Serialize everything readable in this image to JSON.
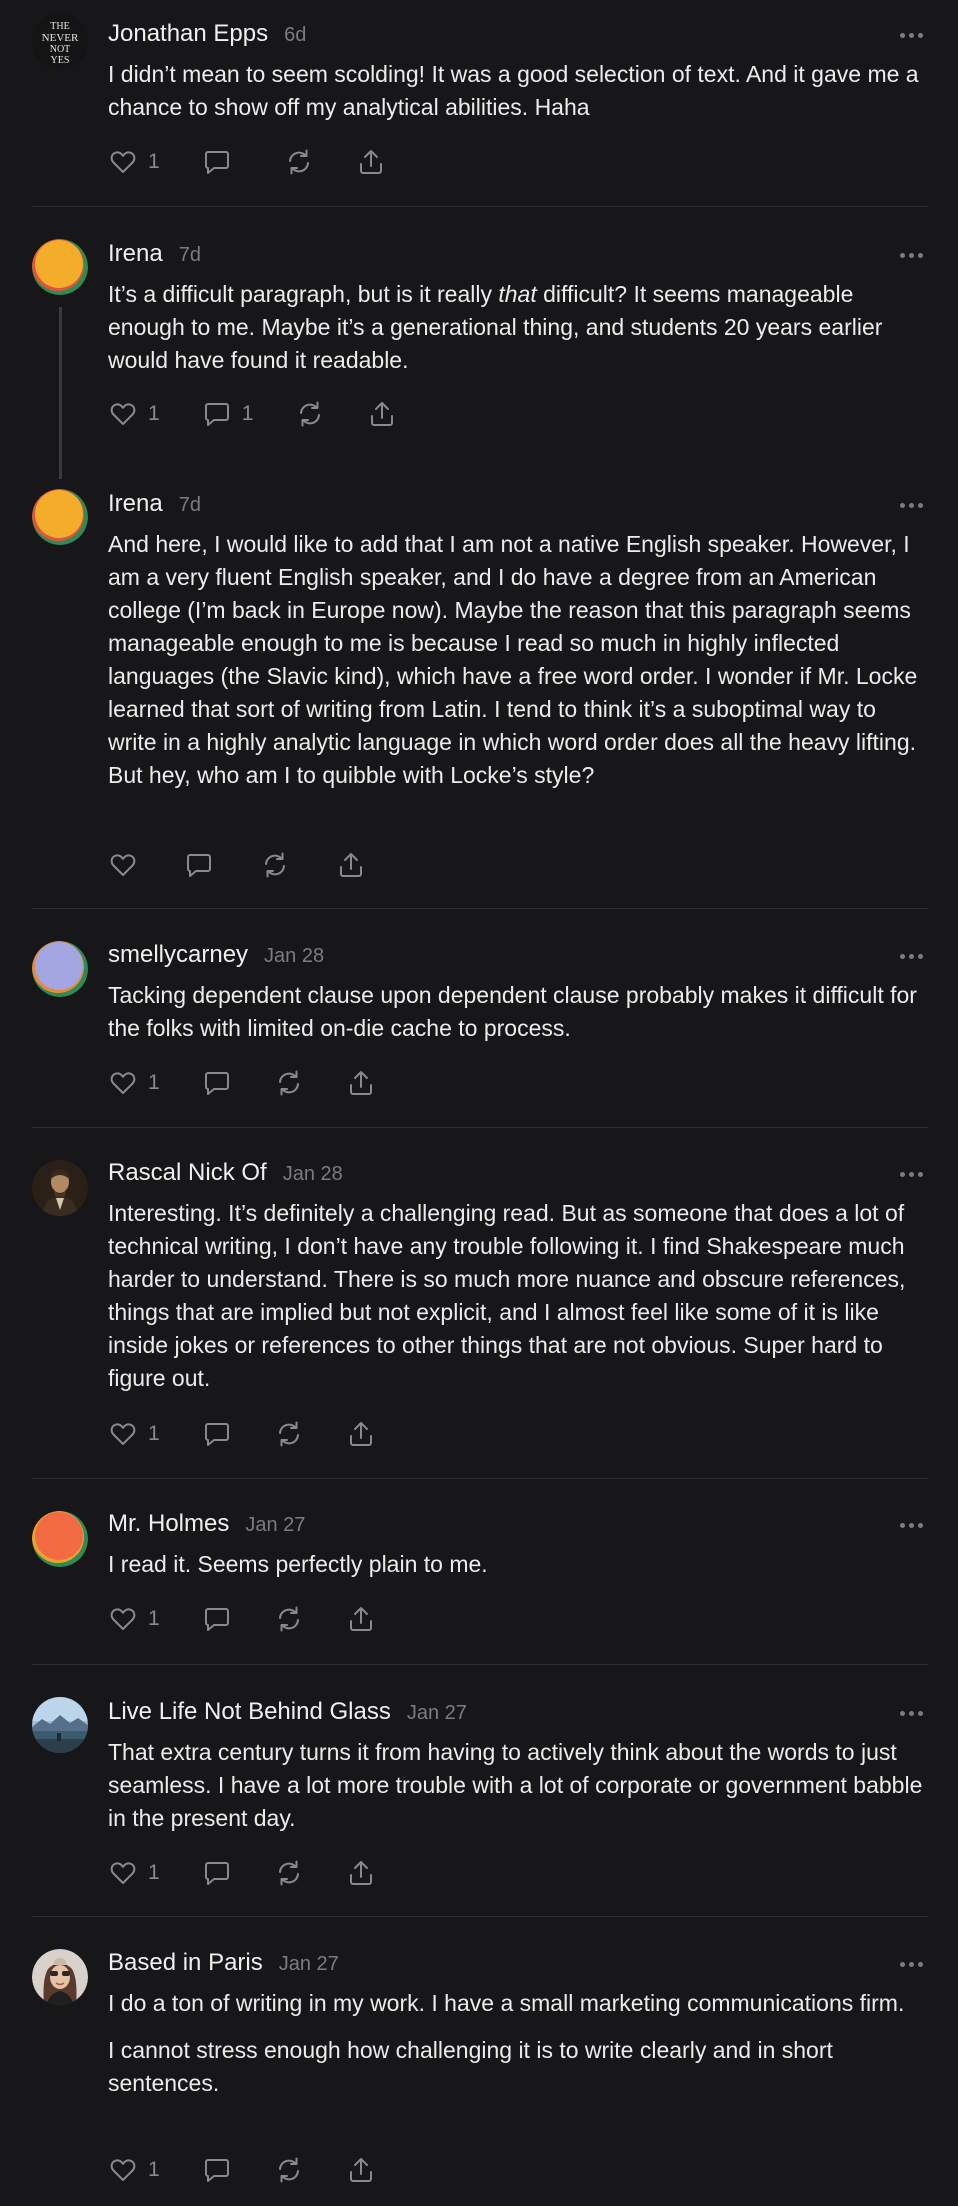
{
  "comments": [
    {
      "author": "Jonathan Epps",
      "time": "6d",
      "avatar": "the-never-not-yes-logo",
      "avatar_text": [
        "THE",
        "NEVER",
        "NOT",
        "YES"
      ],
      "paragraphs": [
        "I didn’t mean to seem scolding! It was a good selection of text. And it gave me a chance to show off my analytical abilities. Haha"
      ],
      "likes": "1",
      "replies": ""
    },
    {
      "author": "Irena",
      "time": "7d",
      "avatar": "orange-green-circle",
      "paragraphs_html": true,
      "paragraph_pre": "It’s a difficult paragraph, but is it really ",
      "paragraph_em": "that",
      "paragraph_post": " difficult? It seems manageable enough to me. Maybe it’s a generational thing, and students 20 years earlier would have found it readable.",
      "likes": "1",
      "replies": "1"
    },
    {
      "author": "Irena",
      "time": "7d",
      "avatar": "orange-green-circle",
      "paragraphs": [
        "And here, I would like to add that I am not a native English speaker. However, I am a very fluent English speaker, and I do have a degree from an American college (I’m back in Europe now). Maybe the reason that this paragraph seems manageable enough to me is because I read so much in highly inflected languages (the Slavic kind), which have a free word order. I wonder if Mr. Locke learned that sort of writing from Latin. I tend to think it’s a suboptimal way to write in a highly analytic language in which word order does all the heavy lifting. But hey, who am I to quibble with Locke’s style?"
      ],
      "likes": "",
      "replies": ""
    },
    {
      "author": "smellycarney",
      "time": "Jan 28",
      "avatar": "lavender-circle",
      "paragraphs": [
        "Tacking dependent clause upon dependent clause probably makes it difficult for the folks with limited on-die cache to process."
      ],
      "likes": "1",
      "replies": ""
    },
    {
      "author": "Rascal Nick Of",
      "time": "Jan 28",
      "avatar": "portrait-photo",
      "paragraphs": [
        "Interesting. It’s definitely a challenging read. But as someone that does a lot of technical writing, I don’t have any trouble following it. I find Shakespeare much harder to understand. There is so much more nuance and obscure references, things that are implied but not explicit, and I almost feel like some of it is like inside jokes or references to other things that are not obvious. Super hard to figure out."
      ],
      "likes": "1",
      "replies": ""
    },
    {
      "author": "Mr. Holmes",
      "time": "Jan 27",
      "avatar": "red-orange-circle",
      "paragraphs": [
        "I read it. Seems perfectly plain to me."
      ],
      "likes": "1",
      "replies": ""
    },
    {
      "author": "Live Life Not Behind Glass",
      "time": "Jan 27",
      "avatar": "landscape-photo",
      "paragraphs": [
        "That extra century turns it from having to actively think about the words to just seamless. I have a lot more trouble with a lot of corporate or government babble in the present day."
      ],
      "likes": "1",
      "replies": ""
    },
    {
      "author": "Based in Paris",
      "time": "Jan 27",
      "avatar": "woman-portrait-photo",
      "paragraphs": [
        "I do a ton of writing in my work. I have a small marketing communications firm.",
        "I cannot stress enough how challenging it is to write clearly and in short sentences."
      ],
      "likes": "1",
      "replies": ""
    }
  ],
  "icons": {
    "like": "heart-icon",
    "reply": "comment-bubble-icon",
    "restack": "restack-arrows-icon",
    "share": "share-icon",
    "more": "more-dots-icon"
  },
  "colors": {
    "background": "#17171a",
    "text": "#ececec",
    "muted": "#7c7c80",
    "separator": "#2e2e32"
  }
}
